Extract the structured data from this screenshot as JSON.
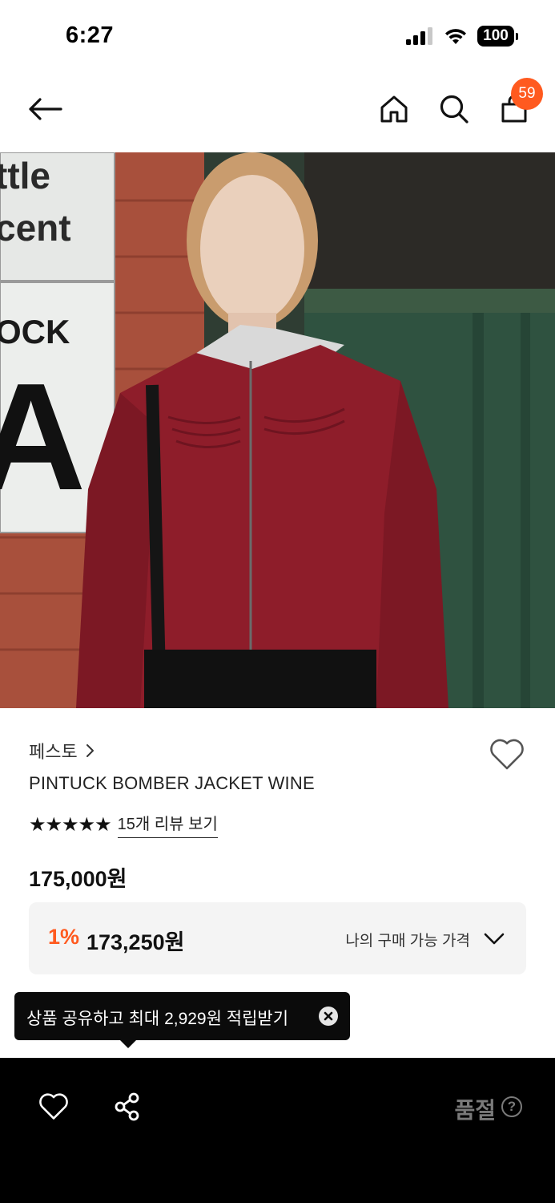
{
  "status_bar": {
    "time": "6:27",
    "battery": "100"
  },
  "nav": {
    "cart_count": "59"
  },
  "product": {
    "brand": "페스토",
    "name": "PINTUCK BOMBER JACKET WINE",
    "stars": "★★★★★",
    "review_link": "15개 리뷰 보기",
    "price": "175,000원",
    "discount_rate": "1%",
    "discount_price": "173,250원",
    "my_price_label": "나의 구매 가능 가격"
  },
  "tooltip": {
    "text": "상품 공유하고 최대 2,929원 적립받기"
  },
  "bottom_bar": {
    "status_label": "품절",
    "help_symbol": "?"
  },
  "colors": {
    "accent": "#ff5a1f",
    "bottom_bar": "#000000",
    "jacket": "#8e1d2a"
  },
  "icons": [
    "back-arrow-icon",
    "home-icon",
    "search-icon",
    "shopping-bag-icon",
    "heart-icon",
    "chevron-right-icon",
    "chevron-down-icon",
    "close-icon",
    "share-icon",
    "help-circle-icon"
  ]
}
